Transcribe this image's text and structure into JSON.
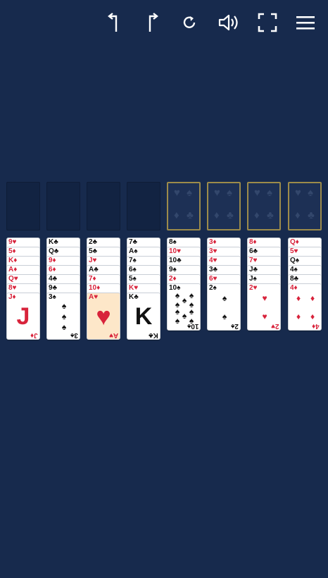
{
  "toolbar": {
    "buttons": [
      {
        "name": "undo-button",
        "icon": "undo-icon",
        "glyph": "↰"
      },
      {
        "name": "redo-button",
        "icon": "redo-icon",
        "glyph": "↱"
      },
      {
        "name": "restart-button",
        "icon": "refresh-icon",
        "glyph": "⟳"
      },
      {
        "name": "sound-button",
        "icon": "volume-icon",
        "glyph": ""
      },
      {
        "name": "fullscreen-button",
        "icon": "fullscreen-icon",
        "glyph": ""
      },
      {
        "name": "menu-button",
        "icon": "menu-icon",
        "glyph": ""
      }
    ]
  },
  "free_cells": 4,
  "foundations": 4,
  "foundation_pips": [
    "♥",
    "♠",
    "♦",
    "♣"
  ],
  "colors": {
    "background": "#172a4d",
    "free_cell": "#122342",
    "foundation_border": "#9c8b4a",
    "red_suit": "#d8233b",
    "black_suit": "#111111",
    "highlight_card": "#fde7c9"
  },
  "columns": [
    {
      "cards": [
        "9♥",
        "5♦",
        "K♦",
        "A♦",
        "Q♥",
        "8♥",
        "J♦"
      ],
      "top_face": "J"
    },
    {
      "cards": [
        "K♣",
        "Q♣",
        "9♦",
        "6♦",
        "4♣",
        "9♣",
        "3♠"
      ],
      "top_face": "♠"
    },
    {
      "cards": [
        "2♣",
        "5♣",
        "J♥",
        "A♣",
        "7♦",
        "10♦",
        "A♥"
      ],
      "top_face": "♥",
      "highlight": true
    },
    {
      "cards": [
        "7♣",
        "A♠",
        "7♠",
        "6♠",
        "5♠",
        "K♥",
        "K♣"
      ],
      "top_face": "K"
    },
    {
      "cards": [
        "8♠",
        "10♥",
        "10♣",
        "9♠",
        "2♦",
        "10♠"
      ],
      "top_face": "♠"
    },
    {
      "cards": [
        "3♦",
        "3♥",
        "4♥",
        "3♣",
        "6♥",
        "2♠"
      ],
      "top_face": "♠"
    },
    {
      "cards": [
        "8♦",
        "6♣",
        "7♥",
        "J♣",
        "J♠",
        "2♥"
      ],
      "top_face": "♥"
    },
    {
      "cards": [
        "Q♦",
        "5♥",
        "Q♠",
        "4♠",
        "8♣",
        "4♦"
      ],
      "top_face": "♦"
    }
  ]
}
